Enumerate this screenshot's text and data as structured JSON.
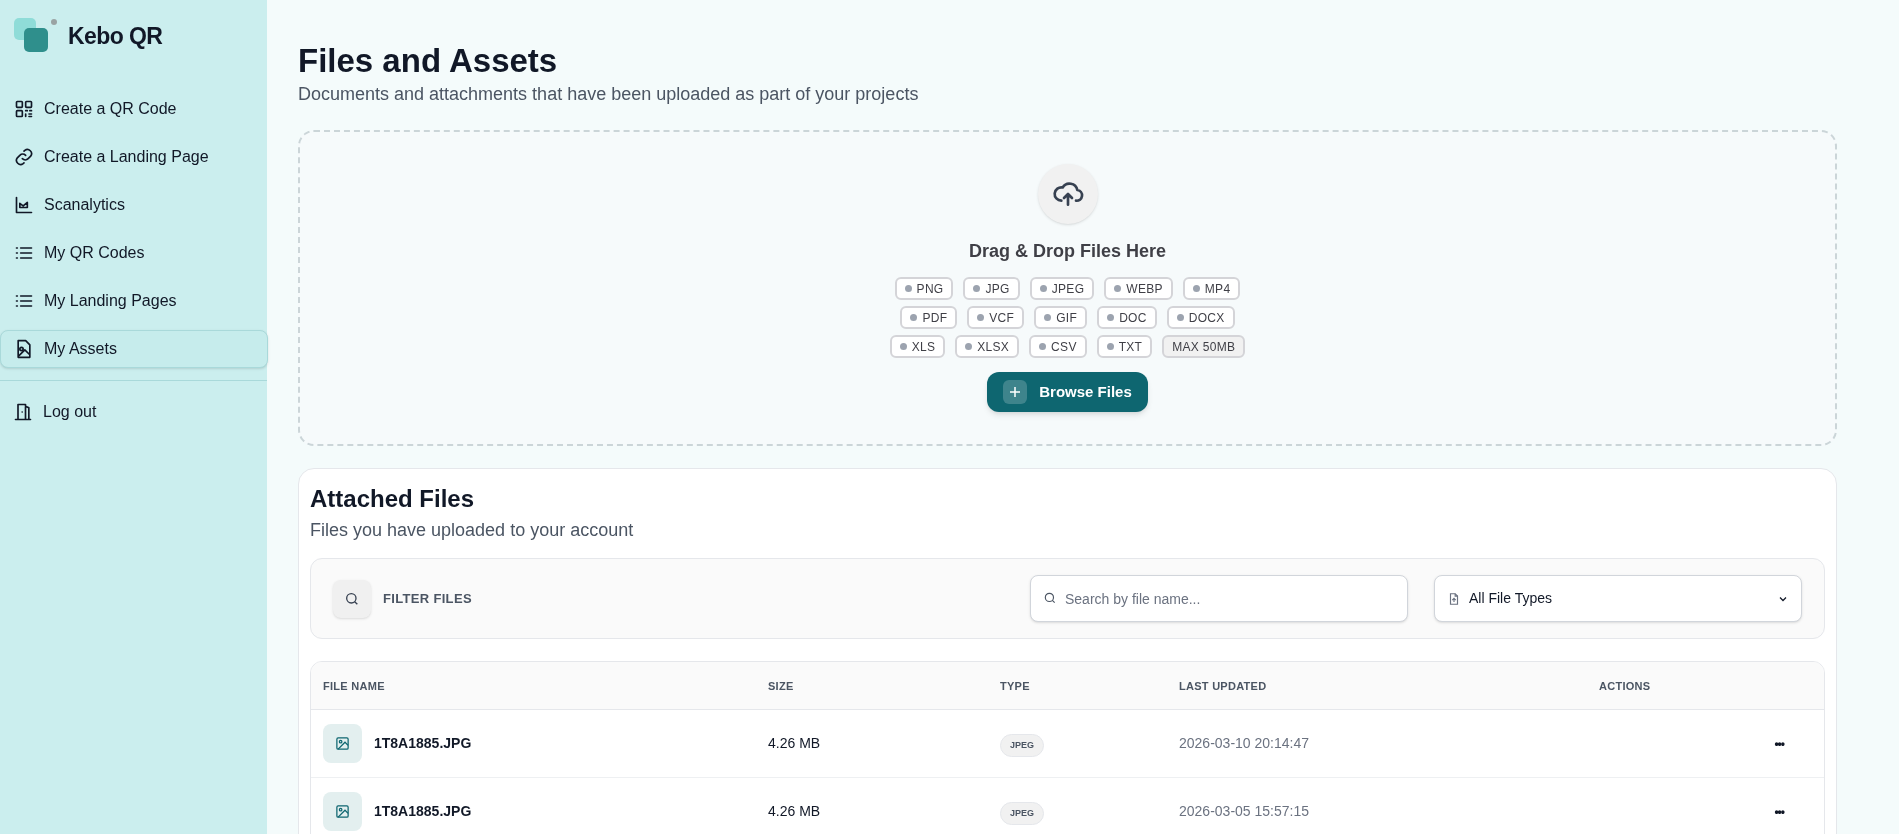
{
  "brand": {
    "name": "Kebo QR"
  },
  "sidebar": {
    "items": [
      {
        "label": "Create a QR Code",
        "kind": "qr",
        "selected": false
      },
      {
        "label": "Create a Landing Page",
        "kind": "link",
        "selected": false
      },
      {
        "label": "Scanalytics",
        "kind": "chart",
        "selected": false
      },
      {
        "label": "My QR Codes",
        "kind": "list",
        "selected": false
      },
      {
        "label": "My Landing Pages",
        "kind": "list",
        "selected": false
      },
      {
        "label": "My Assets",
        "kind": "asset",
        "selected": true
      }
    ],
    "footer_items": [
      {
        "label": "Log out",
        "kind": "door"
      }
    ]
  },
  "page": {
    "title": "Files and Assets",
    "subtitle": "Documents and attachments that have been uploaded as part of your projects"
  },
  "dropzone": {
    "heading": "Drag & Drop Files Here",
    "tag_rows": [
      [
        {
          "label": "PNG",
          "kind": "type"
        },
        {
          "label": "JPG",
          "kind": "type"
        },
        {
          "label": "JPEG",
          "kind": "type"
        },
        {
          "label": "WEBP",
          "kind": "type"
        },
        {
          "label": "MP4",
          "kind": "type"
        }
      ],
      [
        {
          "label": "PDF",
          "kind": "type"
        },
        {
          "label": "VCF",
          "kind": "type"
        },
        {
          "label": "GIF",
          "kind": "type"
        },
        {
          "label": "DOC",
          "kind": "type"
        },
        {
          "label": "DOCX",
          "kind": "type"
        }
      ],
      [
        {
          "label": "XLS",
          "kind": "type"
        },
        {
          "label": "XLSX",
          "kind": "type"
        },
        {
          "label": "CSV",
          "kind": "type"
        },
        {
          "label": "TXT",
          "kind": "type"
        },
        {
          "label": "MAX 50MB",
          "kind": "limit"
        }
      ]
    ],
    "button": "Browse Files"
  },
  "attached": {
    "title": "Attached Files",
    "subtitle": "Files you have uploaded to your account",
    "filter": {
      "label": "FILTER FILES",
      "search_placeholder": "Search by file name...",
      "type_select": "All File Types"
    },
    "table": {
      "columns": [
        "FILE NAME",
        "SIZE",
        "TYPE",
        "LAST UPDATED",
        "ACTIONS"
      ],
      "rows": [
        {
          "name": "1T8A1885.JPG",
          "size": "4.26 MB",
          "type": "JPEG",
          "updated": "2026-03-10 20:14:47",
          "actions": "•••"
        },
        {
          "name": "1T8A1885.JPG",
          "size": "4.26 MB",
          "type": "JPEG",
          "updated": "2026-03-05 15:57:15",
          "actions": "•••"
        }
      ]
    }
  }
}
